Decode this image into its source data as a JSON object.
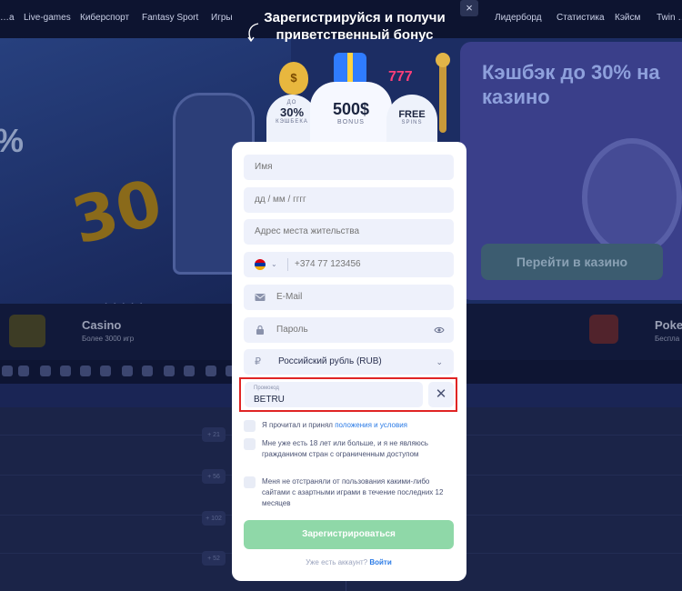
{
  "nav": {
    "items": [
      "…а",
      "Live-games",
      "Киберспорт",
      "Fantasy Sport",
      "Игры",
      "Лидерборд",
      "Статистика",
      "Кэйсм",
      "Twin …"
    ]
  },
  "hero": {
    "cashback_title": "Кэшбэк до 30% на казино",
    "casino_button": "Перейти в казино",
    "pct_left": "%",
    "big_number": "30",
    "carousel_dots": "• • • • •"
  },
  "strip": {
    "casino_title": "Casino",
    "casino_sub": "Более 3000 игр",
    "poker_title": "Poke",
    "poker_sub": "Беспла"
  },
  "odds": [
    "+ 21",
    "+ 56",
    "+ 102",
    "+ 52"
  ],
  "modal": {
    "close_glyph": "×",
    "promo_title": "Зарегистрируйся и получи приветственный бонус",
    "slots": {
      "cashback_prefix": "ДО",
      "cashback_value": "30%",
      "cashback_label": "КЭШБЕКА",
      "bonus_value": "500$",
      "bonus_label": "BONUS",
      "spins_value": "FREE",
      "spins_label": "SPINS",
      "bag_symbol": "$",
      "sevens": "777"
    },
    "form": {
      "name_placeholder": "Имя",
      "dob_placeholder": "дд / мм / гггг",
      "address_placeholder": "Адрес места жительства",
      "phone_placeholder": "+374 77 123456",
      "email_placeholder": "E-Mail",
      "password_placeholder": "Пароль",
      "currency_symbol": "₽",
      "currency_value": "Российский рубль (RUB)",
      "promo_label": "Промокод",
      "promo_value": "BETRU",
      "clear_glyph": "✕",
      "chevron": "⌄"
    },
    "checkboxes": [
      {
        "text": "Я прочитал и принял ",
        "link": "положения и условия"
      },
      {
        "text": "Мне уже есть 18 лет или больше, и я не являюсь гражданином стран с ограниченным доступом"
      },
      {
        "text": "Меня не отстраняли от пользования какими-либо сайтами с азартными играми в течение последних 12 месяцев"
      }
    ],
    "submit_label": "Зарегистрироваться",
    "login_prompt": "Уже есть аккаунт?",
    "login_link": "Войти"
  }
}
